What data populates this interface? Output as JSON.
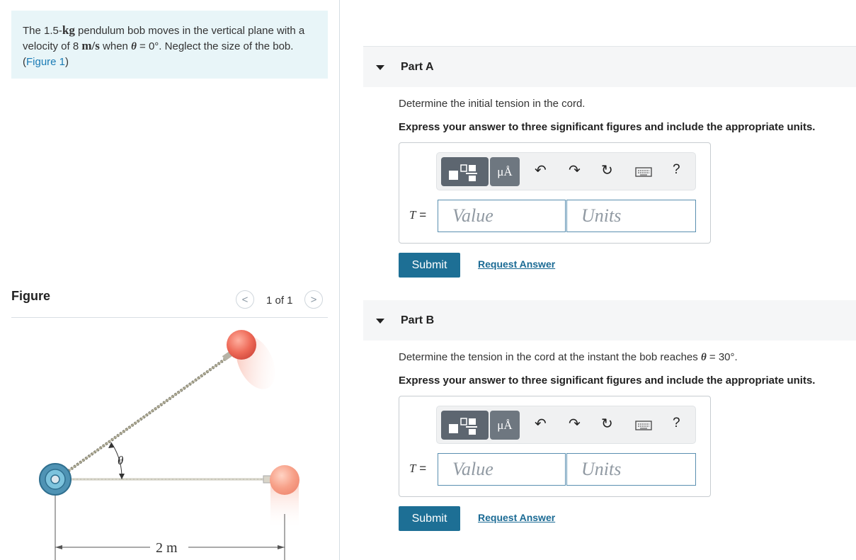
{
  "problem": {
    "text_prefix": "The 1.5-",
    "mass_unit": "kg",
    "text_mid1": " pendulum bob moves in the vertical plane with a velocity of 8 ",
    "velocity_unit": "m/s",
    "text_mid2": " when ",
    "theta": "θ",
    "text_mid3": " = 0°. Neglect the size of the bob. (",
    "figure_link": "Figure 1",
    "text_suffix": ")"
  },
  "figure_panel": {
    "label": "Figure",
    "pager": {
      "prev_icon": "chevron-left-icon",
      "next_icon": "chevron-right-icon",
      "prev_glyph": "<",
      "next_glyph": ">",
      "count": "1 of 1"
    },
    "diagram": {
      "angle_label": "θ",
      "distance_label": "2 m"
    }
  },
  "parts": [
    {
      "title": "Part A",
      "question": "Determine the initial tension in the cord.",
      "instruction": "Express your answer to three significant figures and include the appropriate units.",
      "toolbar": {
        "units_label": "μÅ",
        "help_label": "?"
      },
      "variable": "T",
      "equals": "=",
      "value_placeholder": "Value",
      "units_placeholder": "Units",
      "submit_label": "Submit",
      "request_label": "Request Answer"
    },
    {
      "title": "Part B",
      "question_prefix": "Determine the tension in the cord at the instant the bob reaches ",
      "question_theta": "θ",
      "question_suffix": " = 30°.",
      "instruction": "Express your answer to three significant figures and include the appropriate units.",
      "toolbar": {
        "units_label": "μÅ",
        "help_label": "?"
      },
      "variable": "T",
      "equals": "=",
      "value_placeholder": "Value",
      "units_placeholder": "Units",
      "submit_label": "Submit",
      "request_label": "Request Answer"
    }
  ],
  "colors": {
    "accent": "#1d6f95",
    "link": "#1a7bb5",
    "problem_bg": "#e8f5f8",
    "bob": "#e8584c"
  }
}
